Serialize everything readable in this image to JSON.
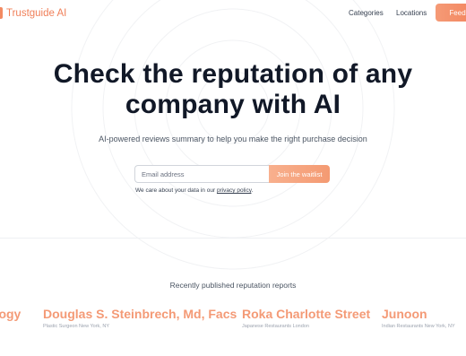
{
  "header": {
    "brand": "Trustguide AI",
    "nav": {
      "categories": "Categories",
      "locations": "Locations"
    },
    "feedback_label": "Feedbac"
  },
  "hero": {
    "title_line1": "Check the reputation of any",
    "title_line2": "company with AI",
    "subtitle": "AI-powered reviews summary to help you make the right purchase decision"
  },
  "form": {
    "email_placeholder": "Email address",
    "button_label": "Join the waitlist",
    "privacy_prefix": "We care about your data in our ",
    "privacy_link": "privacy policy",
    "privacy_suffix": "."
  },
  "recent": {
    "heading": "Recently published reputation reports",
    "reports": [
      {
        "name": "ology",
        "meta": ""
      },
      {
        "name": "Douglas S. Steinbrech, Md, Facs",
        "meta": "Plastic Surgeon New York, NY"
      },
      {
        "name": "Roka Charlotte Street",
        "meta": "Japanese Restaurants London"
      },
      {
        "name": "Junoon",
        "meta": "Indian Restaurants New York, NY"
      }
    ]
  },
  "colors": {
    "accent": "#f0805a",
    "accent_light": "#f49a76",
    "text": "#111827"
  }
}
